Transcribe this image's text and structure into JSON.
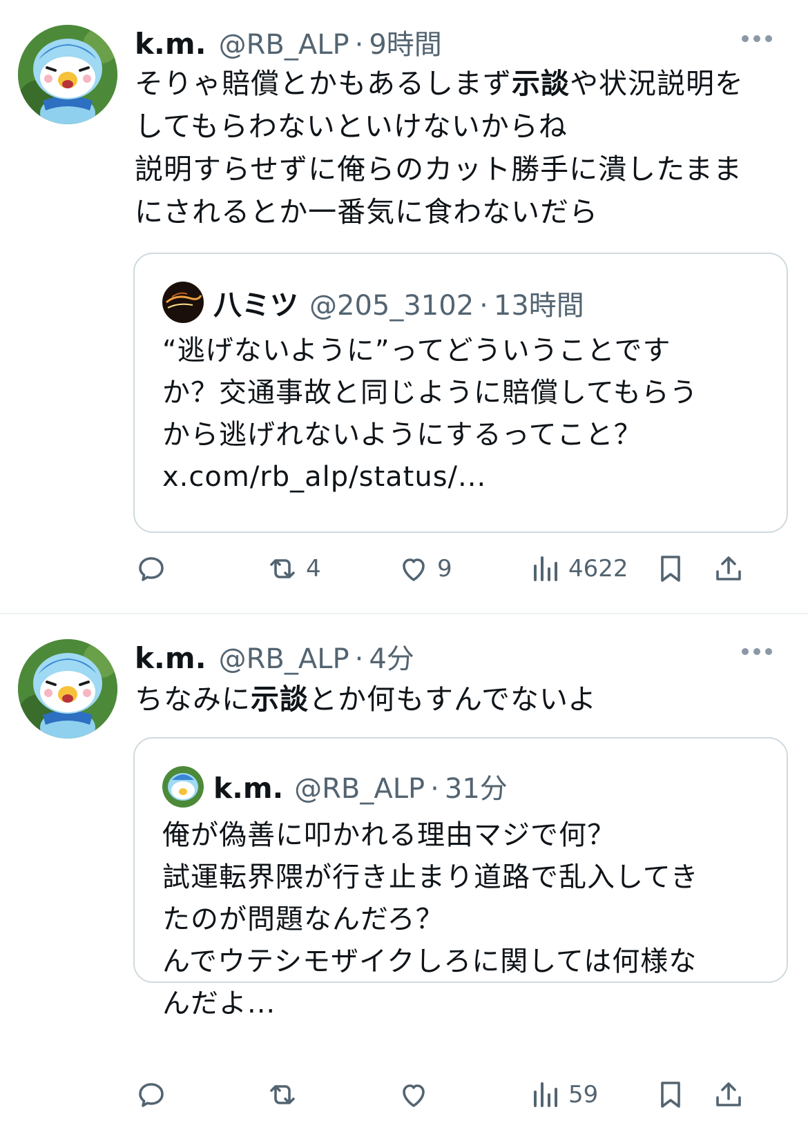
{
  "tweets": [
    {
      "author": {
        "name": "k.m.",
        "handle": "@RB_ALP",
        "time": "9時間"
      },
      "text_lines": [
        [
          "そりゃ賠償とかもあるしまず",
          "示談",
          "や状況説明を"
        ],
        [
          "してもらわないといけないからね"
        ],
        [
          "説明すらせずに俺らのカット勝手に潰したまま"
        ],
        [
          "にされるとか一番気に食わないだら"
        ]
      ],
      "quote": {
        "author": {
          "name": "八ミツ",
          "handle": "@205_3102",
          "time": "13時間"
        },
        "text_lines": [
          "“逃げないように”ってどういうことです",
          "か？交通事故と同じように賠償してもらう",
          "から逃げれないようにするってこと？",
          "x.com/rb_alp/status/..."
        ]
      },
      "actions": {
        "reply": "",
        "retweet": "4",
        "like": "9",
        "views": "4622"
      }
    },
    {
      "author": {
        "name": "k.m.",
        "handle": "@RB_ALP",
        "time": "4分"
      },
      "text_lines": [
        [
          "ちなみに",
          "示談",
          "とか何もすんでないよ"
        ]
      ],
      "quote": {
        "author": {
          "name": "k.m.",
          "handle": "@RB_ALP",
          "time": "31分"
        },
        "text_lines": [
          "俺が偽善に叩かれる理由マジで何？",
          "試運転界隈が行き止まり道路で乱入してき",
          "たのが問題なんだろ？",
          "んでウテシモザイクしろに関しては何様な",
          "んだよ..."
        ]
      },
      "actions": {
        "reply": "",
        "retweet": "",
        "like": "",
        "views": "59"
      }
    }
  ],
  "ui": {
    "dot": "·",
    "colors": {
      "text": "#0f1419",
      "secondary": "#536471",
      "border": "#cfd9de"
    },
    "icons": [
      "reply-icon",
      "retweet-icon",
      "like-icon",
      "views-icon",
      "bookmark-icon",
      "share-icon",
      "more-icon"
    ]
  }
}
